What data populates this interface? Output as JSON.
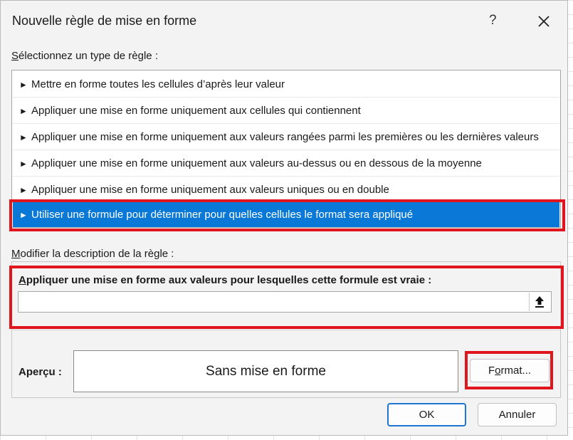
{
  "dialog": {
    "title": "Nouvelle règle de mise en forme",
    "help": "?",
    "close_icon": "close-icon"
  },
  "rule_type": {
    "label_first": "S",
    "label_rest": "électionnez un type de règle :",
    "items": [
      {
        "label": "Mettre en forme toutes les cellules d’après leur valeur",
        "selected": false
      },
      {
        "label": "Appliquer une mise en forme uniquement aux cellules qui contiennent",
        "selected": false
      },
      {
        "label": "Appliquer une mise en forme uniquement aux valeurs rangées parmi les premières ou les dernières valeurs",
        "selected": false
      },
      {
        "label": "Appliquer une mise en forme uniquement aux valeurs au-dessus ou en dessous de la moyenne",
        "selected": false
      },
      {
        "label": "Appliquer une mise en forme uniquement aux valeurs uniques ou en double",
        "selected": false
      },
      {
        "label": "Utiliser une formule pour déterminer pour quelles cellules le format sera appliqué",
        "selected": true
      }
    ],
    "arrow_glyph": "►"
  },
  "description": {
    "label_first": "M",
    "label_rest": "odifier la description de la règle :",
    "formula_label_first": "A",
    "formula_label_rest": "ppliquer une mise en forme aux valeurs pour lesquelles cette formule est vraie :",
    "formula_value": "",
    "collapse_icon": "upload-arrow-icon"
  },
  "preview": {
    "label": "Aperçu :",
    "text": "Sans mise en forme"
  },
  "buttons": {
    "format_first": "F",
    "format_mid": "o",
    "format_rest": "rmat...",
    "ok": "OK",
    "cancel": "Annuler"
  },
  "colors": {
    "selection": "#0a78d7",
    "highlight_box": "#e0151d",
    "ok_border": "#1f76d1"
  }
}
